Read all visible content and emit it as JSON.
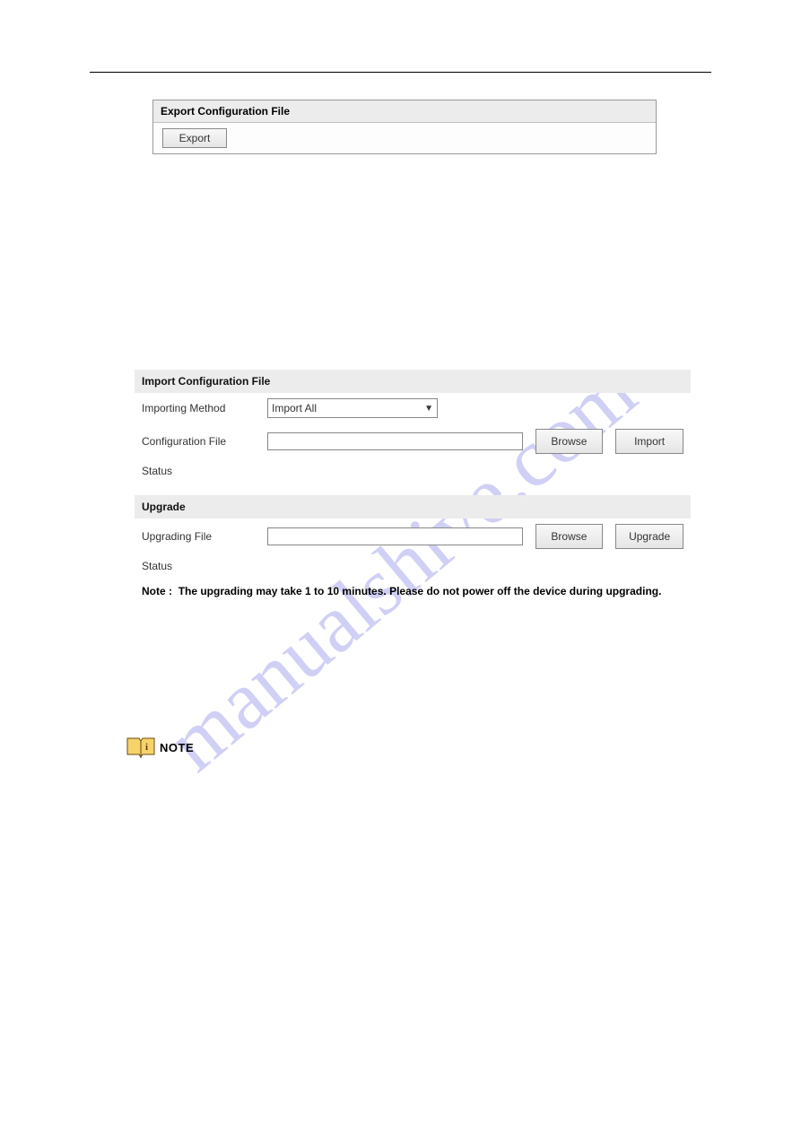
{
  "watermark": "manualshive.com",
  "export": {
    "header": "Export Configuration File",
    "button": "Export"
  },
  "importSection": {
    "header": "Import Configuration File",
    "rows": {
      "methodLabel": "Importing Method",
      "methodValue": "Import All",
      "fileLabel": "Configuration File",
      "browse": "Browse",
      "import": "Import",
      "statusLabel": "Status"
    }
  },
  "upgradeSection": {
    "header": "Upgrade",
    "rows": {
      "fileLabel": "Upgrading File",
      "browse": "Browse",
      "upgrade": "Upgrade",
      "statusLabel": "Status"
    },
    "noteLabel": "Note :",
    "noteText": "The upgrading may take 1 to 10 minutes. Please do not power off the device during upgrading."
  },
  "noteIcon": {
    "label": "NOTE"
  }
}
